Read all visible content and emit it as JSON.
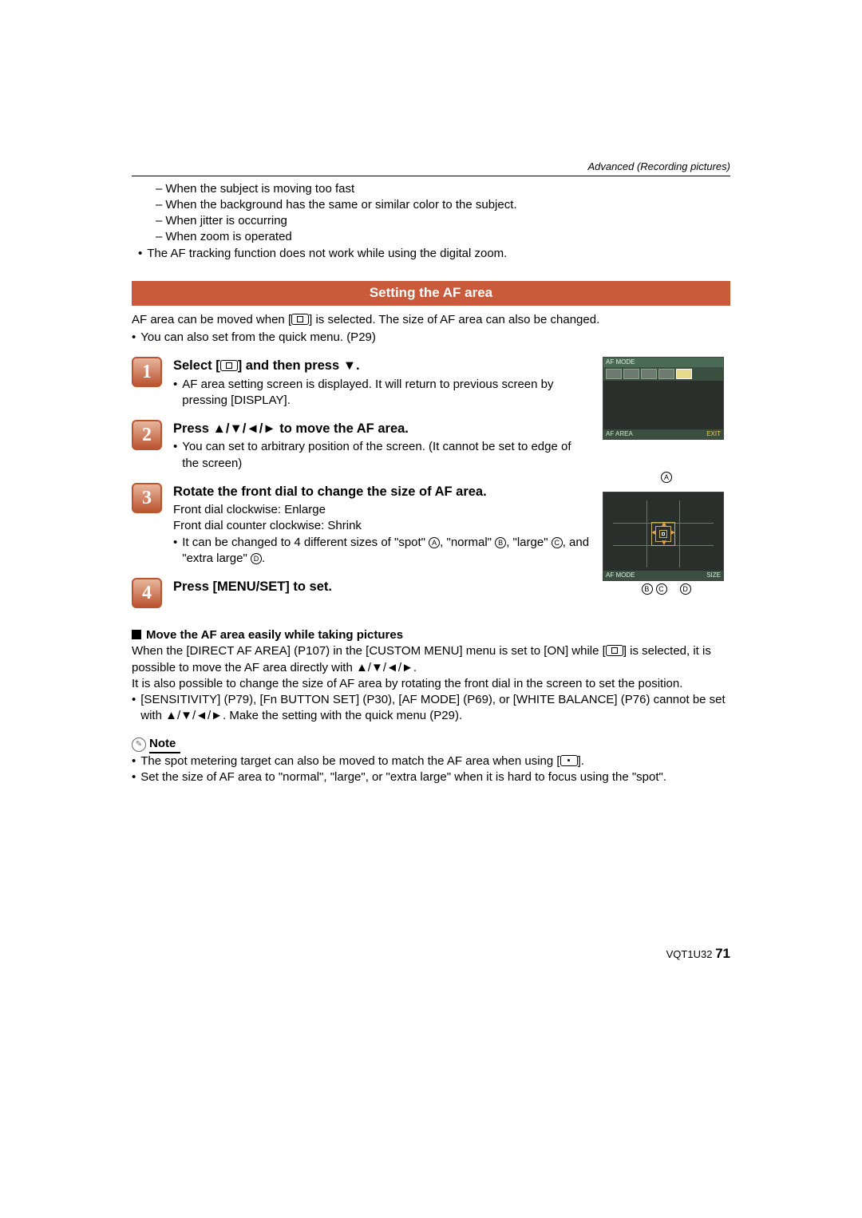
{
  "breadcrumb": "Advanced (Recording pictures)",
  "pre_list": {
    "dashes": [
      "When the subject is moving too fast",
      "When the background has the same or similar color to the subject.",
      "When jitter is occurring",
      "When zoom is operated"
    ],
    "bullet": "The AF tracking function does not work while using the digital zoom."
  },
  "section_title": "Setting the AF area",
  "intro": {
    "line1a": "AF area can be moved when [",
    "line1b": "] is selected. The size of AF area can also be changed.",
    "bullet": "You can also set from the quick menu. (P29)"
  },
  "lcd1": {
    "top": "AF MODE",
    "bottom_left": "AF AREA",
    "bottom_right": "EXIT"
  },
  "lcd2": {
    "callout_top": "A",
    "bottom_left": "AF MODE",
    "bottom_right": "SIZE",
    "callouts_bottom": [
      "B",
      "C",
      "D"
    ]
  },
  "steps": [
    {
      "num": "1",
      "title_a": "Select [",
      "title_b": "] and then press ▼.",
      "sub": "AF area setting screen is displayed. It will return to previous screen by pressing [DISPLAY]."
    },
    {
      "num": "2",
      "title": "Press ▲/▼/◄/► to move the AF area.",
      "sub": "You can set to arbitrary position of the screen. (It cannot be set to edge of the screen)"
    },
    {
      "num": "3",
      "title": "Rotate the front dial to change the size of AF area.",
      "line1": "Front dial clockwise: Enlarge",
      "line2": "Front dial counter clockwise: Shrink",
      "sub_a": "It can be changed to 4 different sizes of \"spot\" ",
      "sub_b": ", \"normal\" ",
      "sub_c": ", \"large\" ",
      "sub_d": ", and \"extra large\" ",
      "sub_e": "."
    },
    {
      "num": "4",
      "title": "Press [MENU/SET] to set."
    }
  ],
  "subh": "Move the AF area easily while taking pictures",
  "para": {
    "p1a": "When the [DIRECT AF AREA] (P107) in the [CUSTOM MENU] menu is set to [ON] while [",
    "p1b": "] is selected, it is possible to move the AF area directly with ▲/▼/◄/►.",
    "p2": "It is also possible to change the size of AF area by rotating the front dial in the screen to set the position.",
    "b1": "[SENSITIVITY] (P79), [Fn BUTTON SET] (P30), [AF MODE] (P69), or [WHITE BALANCE] (P76) cannot be set with ▲/▼/◄/►. Make the setting with the quick menu (P29)."
  },
  "note": {
    "label": "Note",
    "b1a": "The spot metering target can also be moved to match the AF area when using [",
    "b1b": "].",
    "b2": "Set the size of AF area to \"normal\", \"large\", or \"extra large\" when it is hard to focus using the \"spot\"."
  },
  "footer": {
    "code": "VQT1U32",
    "page": "71"
  }
}
